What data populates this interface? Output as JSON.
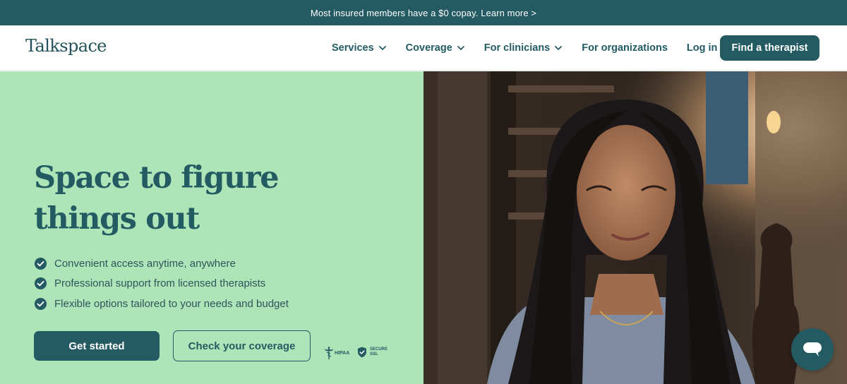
{
  "banner": {
    "text": "Most insured members have a $0 copay. Learn more >"
  },
  "nav": {
    "logo": "Talkspace",
    "items": [
      {
        "label": "Services",
        "dropdown": true
      },
      {
        "label": "Coverage",
        "dropdown": true
      },
      {
        "label": "For clinicians",
        "dropdown": true
      },
      {
        "label": "For organizations",
        "dropdown": false
      },
      {
        "label": "Log in",
        "dropdown": false
      }
    ],
    "cta": "Find a therapist"
  },
  "hero": {
    "headline_light_1": "Space to ",
    "headline_bold_1": "figure",
    "headline_bold_2": "things out",
    "bullets": [
      "Convenient access anytime, anywhere",
      "Professional support from licensed therapists",
      "Flexible options tailored to your needs and budget"
    ],
    "primary_button": "Get started",
    "secondary_button": "Check your coverage",
    "badges": {
      "hipaa": "HIPAA",
      "ssl_line1": "SECURE",
      "ssl_line2": "SSL"
    }
  },
  "colors": {
    "brand": "#245b63",
    "hero_background": "#ade5b8",
    "banner_background": "#245b63"
  },
  "icons": {
    "nav_dropdown": "chevron-down-icon",
    "bullet": "check-circle-icon",
    "hipaa": "caduceus-icon",
    "ssl": "shield-check-icon",
    "chat": "chat-bubble-icon"
  }
}
